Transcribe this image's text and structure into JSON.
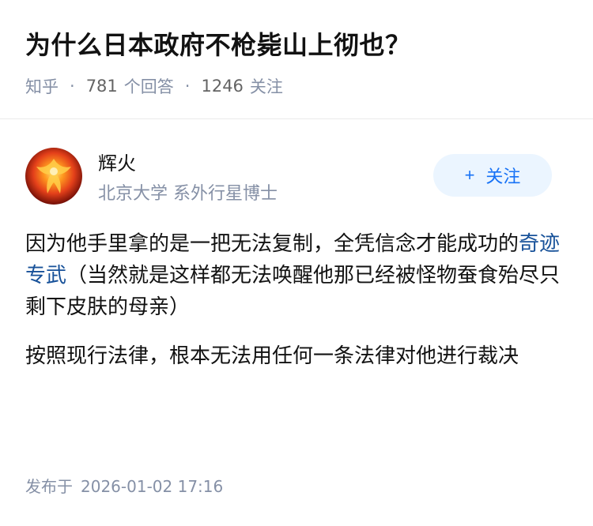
{
  "question": {
    "title": "为什么日本政府不枪毙山上彻也？",
    "source": "知乎",
    "answer_count": "781",
    "answer_label": "个回答",
    "follower_count": "1246",
    "follower_label": "关注",
    "separator": "·"
  },
  "author": {
    "name": "辉火",
    "headline": "北京大学 系外行星博士",
    "follow_plus": "+",
    "follow_label": "关注"
  },
  "answer": {
    "p1_before": "因为他手里拿的是一把无法复制，全凭信念才能成功的",
    "p1_link": "奇迹专武",
    "p1_after": "（当然就是这样都无法唤醒他那已经被怪物蚕食殆尽只剩下皮肤的母亲）",
    "p2": "按照现行法律，根本无法用任何一条法律对他进行裁决"
  },
  "footer": {
    "published_label": "发布于",
    "published_time": "2026-01-02 17:16"
  },
  "colors": {
    "link": "#175199",
    "follow_bg": "#ebf5ff",
    "follow_text": "#1772f6",
    "meta_gray": "#8590a6"
  }
}
